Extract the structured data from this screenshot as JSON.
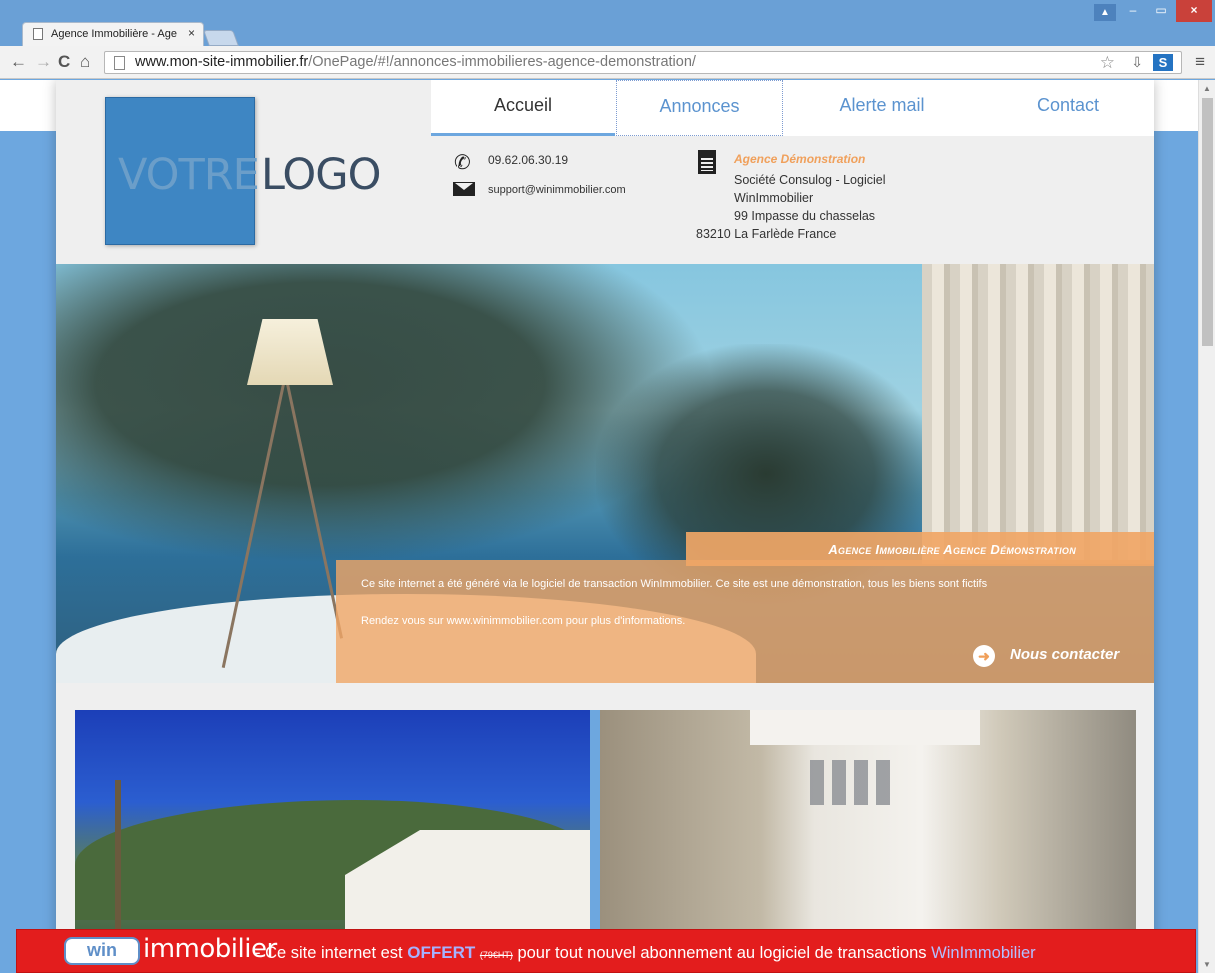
{
  "browser": {
    "tab_title": "Agence Immobilière - Age",
    "url_host": "www.mon-site-immobilier.fr",
    "url_path": "/OnePage/#!/annonces-immobilieres-agence-demonstration/"
  },
  "site": {
    "logo": {
      "word1": "VOTRE",
      "word2": "LOGO"
    },
    "menu": [
      {
        "label": "Accueil"
      },
      {
        "label": "Annonces"
      },
      {
        "label": "Alerte mail"
      },
      {
        "label": "Contact"
      }
    ],
    "contact": {
      "phone": "09.62.06.30.19",
      "email": "support@winimmobilier.com"
    },
    "agency": {
      "name": "Agence Démonstration",
      "line1": "Société Consulog - Logiciel",
      "line2": "WinImmobilier",
      "line3": "99 Impasse du chasselas",
      "line4": "83210 La Farlède France"
    },
    "hero": {
      "title": "Agence Immobilière Agence Démonstration",
      "line1": "Ce site internet a été généré via le logiciel de transaction WinImmobilier. Ce site est une démonstration, tous les biens sont fictifs",
      "line2": "Rendez vous sur www.winimmobilier.com pour plus d'informations.",
      "cta": "Nous contacter"
    }
  },
  "promo": {
    "logo_box": "win",
    "logo_word": "immobilier",
    "text_before": "- Ce site internet est",
    "offert": "OFFERT",
    "strike": "(79€HT)",
    "text_after": "pour tout nouvel abonnement au logiciel de transactions",
    "brand": "WinImmobilier"
  },
  "colors": {
    "accent_blue": "#6da7df",
    "hero_orange": "#f0a05b",
    "promo_red": "#e31d1d"
  }
}
